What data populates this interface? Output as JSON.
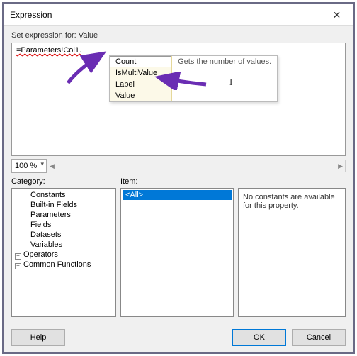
{
  "title": "Expression",
  "set_expr_label": "Set expression for: Value",
  "expression_value": "=Parameters!Col1.",
  "intellisense": {
    "items": [
      "Count",
      "IsMultiValue",
      "Label",
      "Value"
    ],
    "description": "Gets the number of values."
  },
  "zoom": "100 %",
  "panels": {
    "category_label": "Category:",
    "item_label": "Item:",
    "categories": [
      "Constants",
      "Built-in Fields",
      "Parameters",
      "Fields",
      "Datasets",
      "Variables",
      "Operators",
      "Common Functions"
    ],
    "item_selected": "<All>",
    "description": "No constants are available for this property."
  },
  "buttons": {
    "help": "Help",
    "ok": "OK",
    "cancel": "Cancel"
  },
  "icons": {
    "close": "✕",
    "scroll_left": "◀",
    "scroll_right": "▶"
  }
}
